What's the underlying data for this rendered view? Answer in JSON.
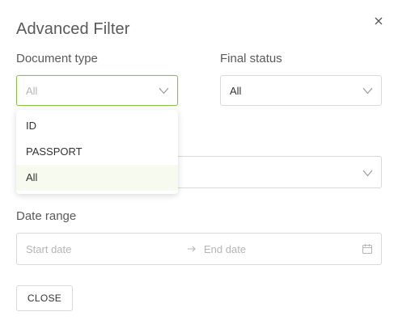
{
  "dialog": {
    "title": "Advanced Filter",
    "close_icon": "close-icon"
  },
  "document_type": {
    "label": "Document type",
    "placeholder": "All",
    "options": [
      "ID",
      "PASSPORT",
      "All"
    ],
    "highlighted_option": "All"
  },
  "final_status": {
    "label": "Final status",
    "value": "All"
  },
  "date_range": {
    "label": "Date range",
    "start_placeholder": "Start date",
    "end_placeholder": "End date",
    "separator_icon": "arrow-right-icon",
    "calendar_icon": "calendar-icon"
  },
  "footer": {
    "close_label": "CLOSE"
  },
  "colors": {
    "focus_border": "#8bc34a",
    "highlight_bg": "#f7faef",
    "text": "#595959",
    "border": "#d9d9d9"
  }
}
